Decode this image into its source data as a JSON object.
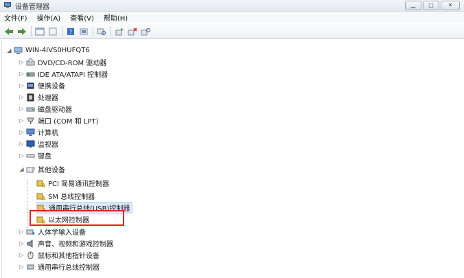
{
  "window": {
    "title": "设备管理器"
  },
  "menu": [
    "文件(F)",
    "操作(A)",
    "查看(V)",
    "帮助(H)"
  ],
  "toolbar": {
    "buttons": [
      "back-icon",
      "forward-icon",
      "sep",
      "properties-window-icon",
      "help-page-icon",
      "sep",
      "help-book-icon",
      "update-driver-icon",
      "sep",
      "scan-hardware-icon",
      "sep",
      "update-icon",
      "uninstall-icon",
      "disable-icon"
    ]
  },
  "tree": {
    "root": "WIN-4IVS0HUFQT6",
    "items": [
      {
        "label": "DVD/CD-ROM 驱动器"
      },
      {
        "label": "IDE ATA/ATAPI 控制器"
      },
      {
        "label": "便携设备"
      },
      {
        "label": "处理器"
      },
      {
        "label": "磁盘驱动器"
      },
      {
        "label": "端口 (COM 和 LPT)"
      },
      {
        "label": "计算机"
      },
      {
        "label": "监视器"
      },
      {
        "label": "键盘"
      },
      {
        "label": "其他设备"
      },
      {
        "label": "PCI 简易通讯控制器"
      },
      {
        "label": "SM 总线控制器"
      },
      {
        "label": "通用串行总线(USB)控制器"
      },
      {
        "label": "以太网控制器"
      },
      {
        "label": "人体学输入设备"
      },
      {
        "label": "声音、视频和游戏控制器"
      },
      {
        "label": "鼠标和其他指针设备"
      },
      {
        "label": "通用串行总线控制器"
      }
    ]
  }
}
